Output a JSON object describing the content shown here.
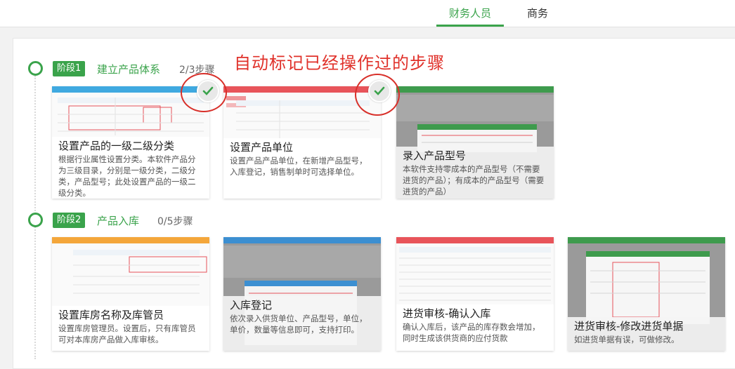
{
  "tabs": [
    {
      "label": "财务人员",
      "active": true
    },
    {
      "label": "商务",
      "active": false
    }
  ],
  "annotation": "自动标记已经操作过的步骤",
  "stages": [
    {
      "badge": "阶段1",
      "title": "建立产品体系",
      "progress": "2/3步骤",
      "cards": [
        {
          "title": "设置产品的一级二级分类",
          "desc": "根据行业属性设置分类。本软件产品分为三级目录，分别是一级分类，二级分类，产品型号；此处设置产品的一级二级分类。",
          "done": true
        },
        {
          "title": "设置产品单位",
          "desc": "设置产品产品单位，在新增产品型号，入库登记，销售制单时可选择单位。",
          "done": true
        },
        {
          "title": "录入产品型号",
          "desc": "本软件支持零成本的产品型号（不需要进货的产品）；有成本的产品型号（需要进货的产品）",
          "done": false
        }
      ]
    },
    {
      "badge": "阶段2",
      "title": "产品入库",
      "progress": "0/5步骤",
      "cards": [
        {
          "title": "设置库房名称及库管员",
          "desc": "设置库房管理员。设置后，只有库管员可对本库房产品做入库审核。",
          "done": false
        },
        {
          "title": "入库登记",
          "desc": "依次录入供货单位、产品型号，单位，单价，数量等信息即可，支持打印。",
          "done": false
        },
        {
          "title": "进货审核-确认入库",
          "desc": "确认入库后，该产品的库存数会增加，同时生成该供货商的应付货款",
          "done": false
        },
        {
          "title": "进货审核-修改进货单据",
          "desc": "如进货单据有误，可做修改。",
          "done": false
        }
      ]
    }
  ],
  "colors": {
    "accent": "#3aa34b",
    "annotation": "#e0312a",
    "card_headers": [
      "#3fa9e0",
      "#e8545a",
      "#3e9b4d",
      "#f4a63a",
      "#3c8fd1",
      "#e8545a",
      "#3e9b4d"
    ]
  },
  "icons": {
    "check": "checkmark-icon"
  }
}
